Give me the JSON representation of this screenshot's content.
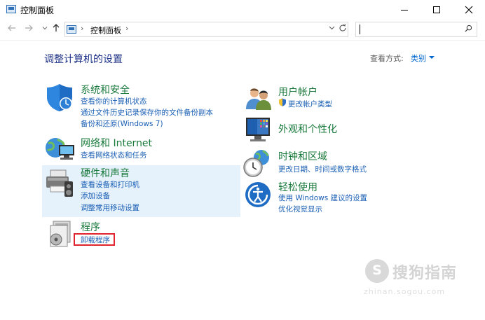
{
  "window": {
    "title": "控制面板"
  },
  "address": {
    "crumb": "控制面板",
    "search_placeholder": ""
  },
  "page": {
    "title": "调整计算机的设置",
    "view_by_label": "查看方式:",
    "view_by_value": "类别"
  },
  "categories": [
    {
      "title": "系统和安全",
      "links": [
        "查看你的计算机状态",
        "通过文件历史记录保存你的文件备份副本",
        "备份和还原(Windows 7)"
      ]
    },
    {
      "title": "网络和 Internet",
      "links": [
        "查看网络状态和任务"
      ]
    },
    {
      "title": "硬件和声音",
      "links": [
        "查看设备和打印机",
        "添加设备",
        "调整常用移动设置"
      ]
    },
    {
      "title": "程序",
      "links": [
        "卸载程序"
      ]
    },
    {
      "title": "用户帐户",
      "links": [
        "更改帐户类型"
      ]
    },
    {
      "title": "外观和个性化",
      "links": []
    },
    {
      "title": "时钟和区域",
      "links": [
        "更改日期、时间或数字格式"
      ]
    },
    {
      "title": "轻松使用",
      "links": [
        "使用 Windows 建议的设置",
        "优化视觉显示"
      ]
    }
  ],
  "watermark": {
    "logo_letter": "S",
    "text": "搜狗指南",
    "url": "zhinan.sogou.com"
  },
  "colors": {
    "category_title": "#1a7a3c",
    "link": "#1a5fb4",
    "hover_bg": "#e5f1fb",
    "highlight_border": "#e0242d",
    "page_title": "#1e3287"
  }
}
